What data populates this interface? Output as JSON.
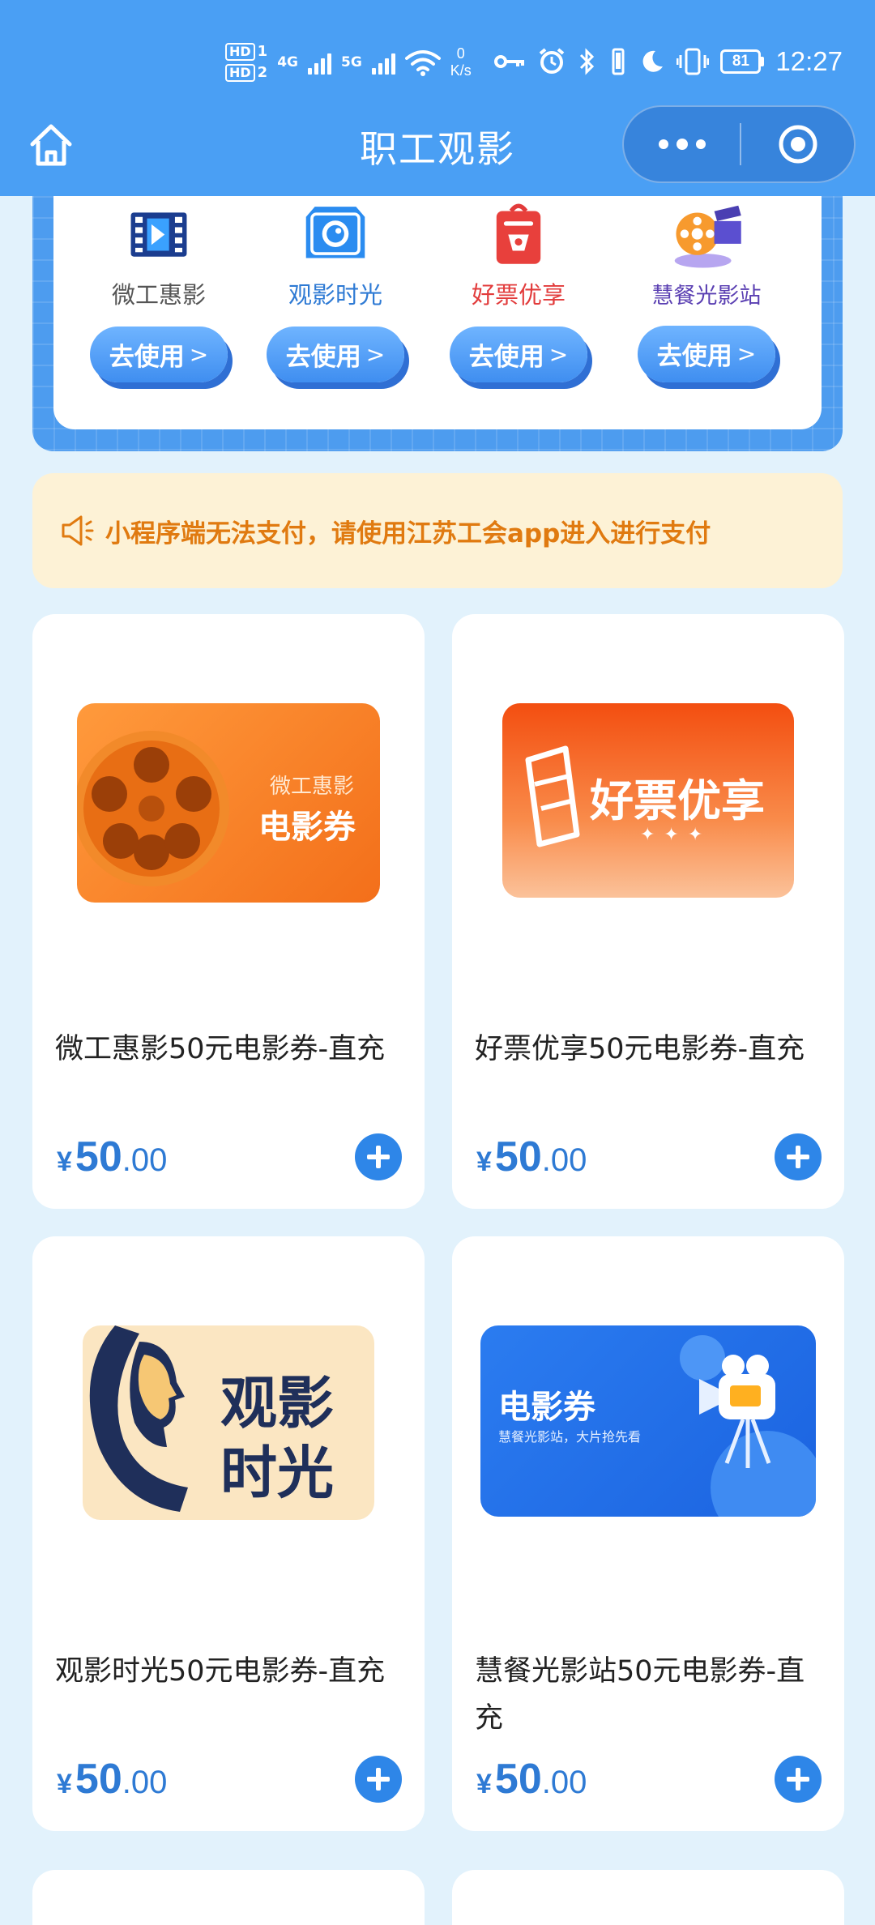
{
  "status_bar": {
    "hd1": "HD",
    "hd1_sub": "1",
    "hd2": "HD",
    "hd2_sub": "2",
    "net1": "4G",
    "net2": "5G",
    "speed_value": "0",
    "speed_unit": "K/s",
    "battery": "81",
    "time": "12:27",
    "icons": [
      "key-icon",
      "alarm-icon",
      "bluetooth-icon",
      "vibrate-icon",
      "moon-icon"
    ]
  },
  "header": {
    "title": "职工观影",
    "home_icon": "home-icon",
    "more_icon": "more-dots-icon",
    "close_icon": "target-close-icon"
  },
  "platforms": [
    {
      "name": "微工惠影",
      "button": "去使用",
      "arrow": ">",
      "name_color": "#555555",
      "icon": "film-clapper-icon"
    },
    {
      "name": "观影时光",
      "button": "去使用",
      "arrow": ">",
      "name_color": "#2e7ad4",
      "icon": "camera-lens-icon"
    },
    {
      "name": "好票优享",
      "button": "去使用",
      "arrow": ">",
      "name_color": "#e23b3b",
      "icon": "ticket-bag-icon"
    },
    {
      "name": "慧餐光影站",
      "button": "去使用",
      "arrow": ">",
      "name_color": "#5a3fb2",
      "icon": "film-reel-icon"
    }
  ],
  "notice": {
    "icon": "speaker-icon",
    "text": "小程序端无法支付，请使用江苏工会app进入进行支付"
  },
  "products": [
    {
      "title": "微工惠影50元电影券-直充",
      "currency": "¥",
      "price_int": "50",
      "price_dec": ".00",
      "thumb_small": "微工惠影",
      "thumb_big": "电影券"
    },
    {
      "title": "好票优享50元电影券-直充",
      "currency": "¥",
      "price_int": "50",
      "price_dec": ".00",
      "thumb_big": "好票优享",
      "thumb_deco": "✦ ✦ ✦"
    },
    {
      "title": "观影时光50元电影券-直充",
      "currency": "¥",
      "price_int": "50",
      "price_dec": ".00",
      "thumb_line1": "观影",
      "thumb_line2": "时光"
    },
    {
      "title": "慧餐光影站50元电影券-直充",
      "currency": "¥",
      "price_int": "50",
      "price_dec": ".00",
      "thumb_big": "电影券",
      "thumb_small": "慧餐光影站，大片抢先看"
    }
  ],
  "colors": {
    "header_bg": "#4a9ff4",
    "page_bg": "#e2f2fc",
    "price": "#2e7ad4",
    "notice_text": "#e07a10",
    "notice_bg": "#fdf2d6"
  }
}
